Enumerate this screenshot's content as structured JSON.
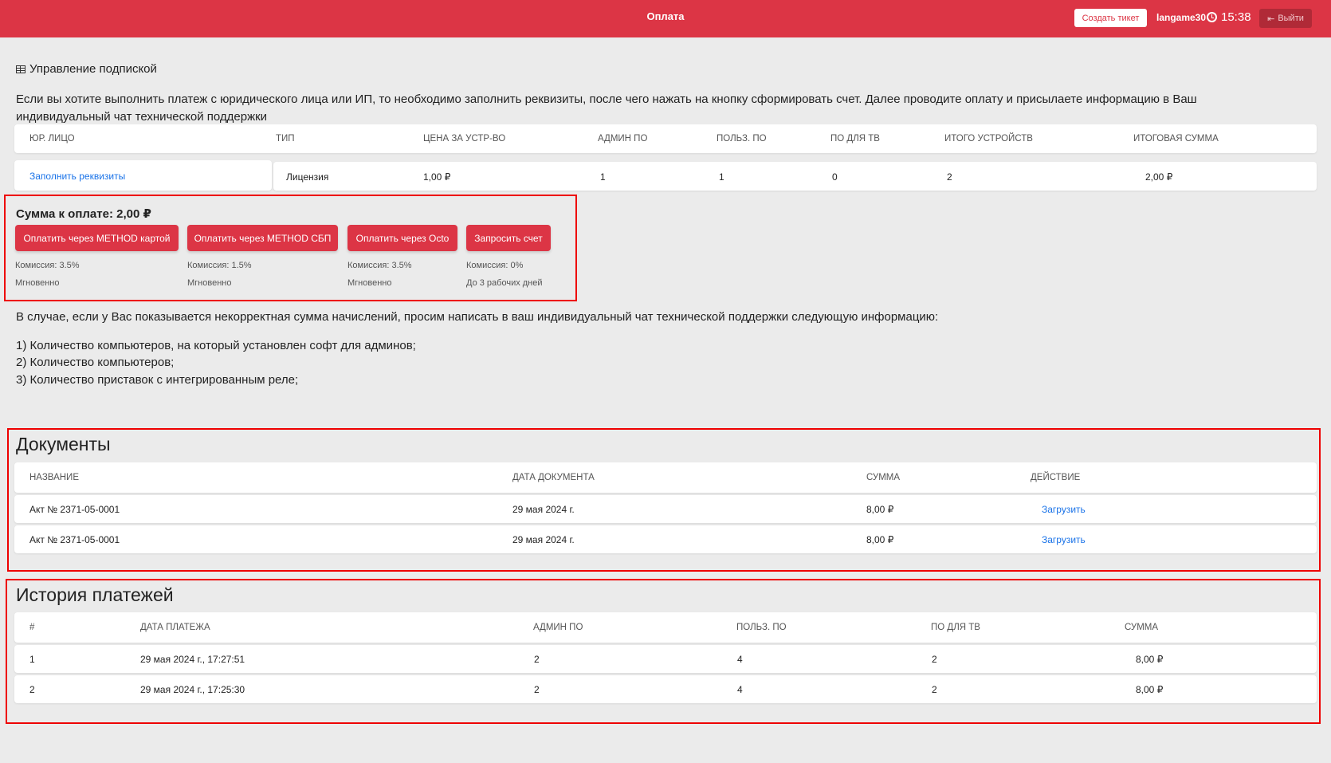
{
  "header": {
    "title": "Оплата",
    "ticket_button": "Создать тикет",
    "username": "langame30",
    "time": "15:38",
    "logout": "Выйти"
  },
  "subscription": {
    "heading": "Управление подпиской",
    "intro": "Если вы хотите выполнить платеж с юридического лица или ИП, то необходимо заполнить реквизиты, после чего нажать на кнопку сформировать счет. Далее проводите оплату и присылаете информацию в Ваш индивидуальный чат технической поддержки",
    "columns": [
      "ЮР. ЛИЦО",
      "ТИП",
      "ЦЕНА ЗА УСТР-ВО",
      "АДМИН ПО",
      "ПОЛЬЗ. ПО",
      "ПО ДЛЯ ТВ",
      "ИТОГО УСТРОЙСТВ",
      "ИТОГОВАЯ СУММА"
    ],
    "row": {
      "legal": "Заполнить реквизиты",
      "type": "Лицензия",
      "price": "1,00 ₽",
      "admin": "1",
      "user": "1",
      "tv": "0",
      "total_devices": "2",
      "total_sum": "2,00 ₽"
    }
  },
  "payment": {
    "sum_label": "Сумма к оплате: 2,00 ₽",
    "buttons": [
      {
        "label": "Оплатить через METHOD картой",
        "fee": "Комиссия: 3.5%",
        "time": "Мгновенно"
      },
      {
        "label": "Оплатить через METHOD СБП",
        "fee": "Комиссия: 1.5%",
        "time": "Мгновенно"
      },
      {
        "label": "Оплатить через Octo",
        "fee": "Комиссия: 3.5%",
        "time": "Мгновенно"
      },
      {
        "label": "Запросить счет",
        "fee": "Комиссия: 0%",
        "time": "До 3 рабочих дней"
      }
    ]
  },
  "notice": {
    "text": "В случае, если у Вас показывается некорректная сумма начислений, просим написать в ваш индивидуальный чат технической поддержки следующую информацию:",
    "items": [
      "1) Количество компьютеров, на который установлен софт для админов;",
      "2) Количество компьютеров;",
      "3) Количество приставок с интегрированным реле;"
    ]
  },
  "documents": {
    "title": "Документы",
    "columns": [
      "НАЗВАНИЕ",
      "ДАТА ДОКУМЕНТА",
      "СУММА",
      "ДЕЙСТВИЕ"
    ],
    "rows": [
      {
        "name": "Акт № 2371-05-0001",
        "date": "29 мая 2024 г.",
        "sum": "8,00 ₽",
        "action": "Загрузить"
      },
      {
        "name": "Акт № 2371-05-0001",
        "date": "29 мая 2024 г.",
        "sum": "8,00 ₽",
        "action": "Загрузить"
      }
    ]
  },
  "history": {
    "title": "История платежей",
    "columns": [
      "#",
      "ДАТА ПЛАТЕЖА",
      "АДМИН ПО",
      "ПОЛЬЗ. ПО",
      "ПО ДЛЯ ТВ",
      "СУММА"
    ],
    "rows": [
      {
        "num": "1",
        "date": "29 мая 2024 г., 17:27:51",
        "admin": "2",
        "user": "4",
        "tv": "2",
        "sum": "8,00 ₽"
      },
      {
        "num": "2",
        "date": "29 мая 2024 г., 17:25:30",
        "admin": "2",
        "user": "4",
        "tv": "2",
        "sum": "8,00 ₽"
      }
    ]
  },
  "colors": {
    "primary": "#dc3545",
    "link": "#1a73e8",
    "background": "#ebebeb",
    "highlight_box": "#ee0000"
  }
}
